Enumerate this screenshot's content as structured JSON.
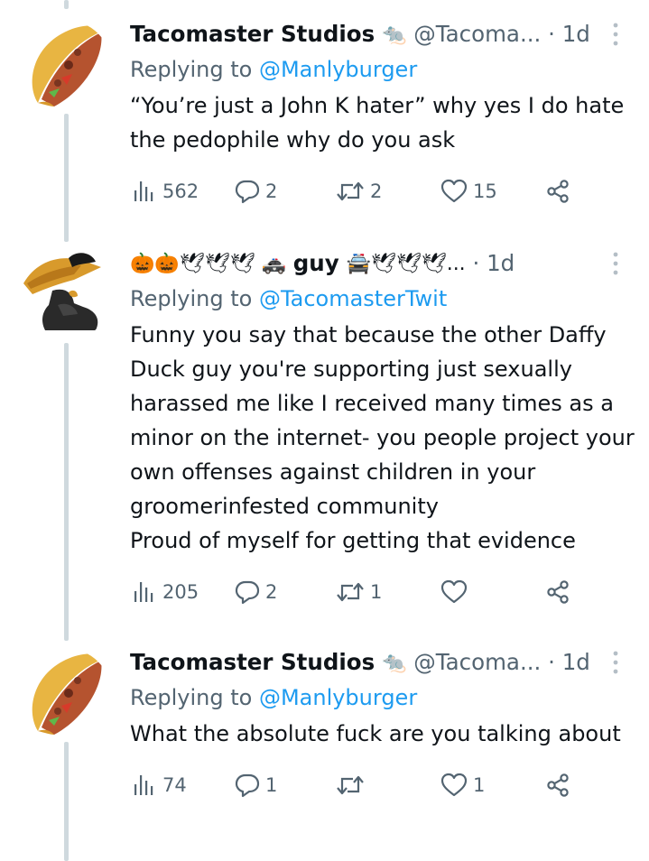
{
  "tweets": [
    {
      "display_name": "Tacomaster Studios",
      "name_emoji": "🐀",
      "handle": "@Tacoma...",
      "dot": "·",
      "time": "1d",
      "replying_prefix": "Replying to ",
      "replying_to": "@Manlyburger",
      "text": "“You’re just a John K hater” why yes I do hate the pedophile why do you ask",
      "views": "562",
      "replies": "2",
      "retweets": "2",
      "likes": "15",
      "avatar_icon": "taco-icon"
    },
    {
      "name_prefix_emoji": "🎃🎃🕊🕊🕊 🚓",
      "display_name": "guy",
      "name_suffix_emoji": "🚔🕊🕊🕊...",
      "dot": "·",
      "time": "1d",
      "replying_prefix": "Replying to ",
      "replying_to": "@TacomasterTwit",
      "text": "Funny you say that because the other Daffy Duck guy you're supporting just sexually harassed me like I received many times as a minor on the internet- you people project your own offenses against children in your groomerinfested community\nProud of myself for getting that evidence",
      "views": "205",
      "replies": "2",
      "retweets": "1",
      "likes": "",
      "avatar_icon": "duck-icon"
    },
    {
      "display_name": "Tacomaster Studios",
      "name_emoji": "🐀",
      "handle": "@Tacoma...",
      "dot": "·",
      "time": "1d",
      "replying_prefix": "Replying to ",
      "replying_to": "@Manlyburger",
      "text": "What the absolute fuck are you talking about",
      "views": "74",
      "replies": "1",
      "retweets": "",
      "likes": "1",
      "avatar_icon": "taco-icon"
    }
  ],
  "colors": {
    "link": "#1d9bf0",
    "muted": "#536471",
    "text": "#0f1419",
    "thread_line": "#cfd9de"
  }
}
